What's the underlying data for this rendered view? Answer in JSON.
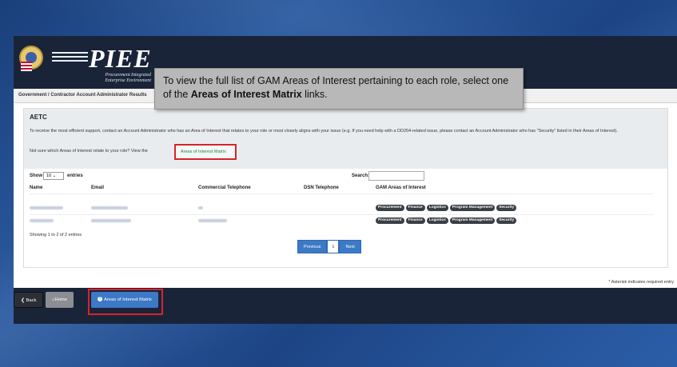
{
  "header": {
    "logo_title": "PIEE",
    "logo_sub_line1": "Procurement Integrated",
    "logo_sub_line2": "Enterprise Environment"
  },
  "tooltip": {
    "text_pre": "To view the full list of GAM Areas of Interest pertaining to each role, select one of the ",
    "text_bold": "Areas of Interest Matrix",
    "text_post": " links."
  },
  "results": {
    "title": "Government / Contractor Account Administrator Results"
  },
  "panel": {
    "heading": "AETC",
    "info": "To receive the most efficient support, contact an Account Administrator who has an Area of Interest that relates to your role or most closely aligns with your issue (e.g. If you need help with a DD254-related issue, please contact an Account Administrator who has \"Security\" listed in their Areas of Interest).",
    "not_sure": "Not sure which Areas of Interest relate to your role? View the",
    "matrix_link": "Areas of Interest Matrix"
  },
  "table": {
    "show_label": "Show",
    "page_size": "10",
    "entries_label": "entries",
    "search_label": "Search:",
    "columns": [
      "Name",
      "Email",
      "Commercial Telephone",
      "DSN Telephone",
      "GAM Areas of Interest"
    ],
    "rows": [
      {
        "areas": [
          "Procurement",
          "Finance",
          "Logistics",
          "Program Management",
          "Security"
        ]
      },
      {
        "areas": [
          "Procurement",
          "Finance",
          "Logistics",
          "Program Management",
          "Security"
        ]
      }
    ],
    "showing": "Showing 1 to 2 of 2 entries",
    "pager": {
      "previous": "Previous",
      "page": "1",
      "next": "Next"
    }
  },
  "asterisk_note": "* Asterisk indicates required entry",
  "footer": {
    "back": "Back",
    "home": "Home",
    "matrix": "Areas of Interest Matrix"
  },
  "colors": {
    "accent_blue": "#3c79c7",
    "highlight_red": "#d8232a",
    "link_green": "#1e8e3e",
    "badge_dark": "#3a3f46"
  }
}
